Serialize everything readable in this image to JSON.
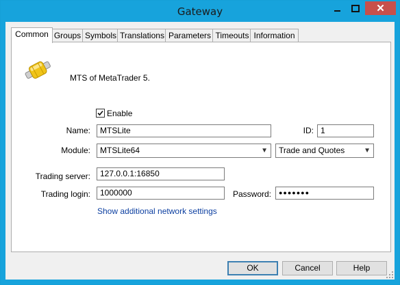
{
  "window": {
    "title": "Gateway"
  },
  "tabs": [
    {
      "label": "Common"
    },
    {
      "label": "Groups"
    },
    {
      "label": "Symbols"
    },
    {
      "label": "Translations"
    },
    {
      "label": "Parameters"
    },
    {
      "label": "Timeouts"
    },
    {
      "label": "Information"
    }
  ],
  "header": {
    "description": "MTS of MetaTrader 5."
  },
  "form": {
    "enable_label": "Enable",
    "enable_checked": true,
    "name_label": "Name:",
    "name_value": "MTSLite",
    "id_label": "ID:",
    "id_value": "1",
    "module_label": "Module:",
    "module_value": "MTSLite64",
    "mode_value": "Trade and Quotes",
    "server_label": "Trading server:",
    "server_value": "127.0.0.1:16850",
    "login_label": "Trading login:",
    "login_value": "1000000",
    "password_label": "Password:",
    "password_value": "●●●●●●●",
    "network_link": "Show additional network settings"
  },
  "buttons": {
    "ok": "OK",
    "cancel": "Cancel",
    "help": "Help"
  },
  "icons": {
    "gateway": "gateway-connector-icon",
    "close": "close-icon",
    "minimize": "minimize-icon",
    "maximize": "maximize-icon"
  }
}
